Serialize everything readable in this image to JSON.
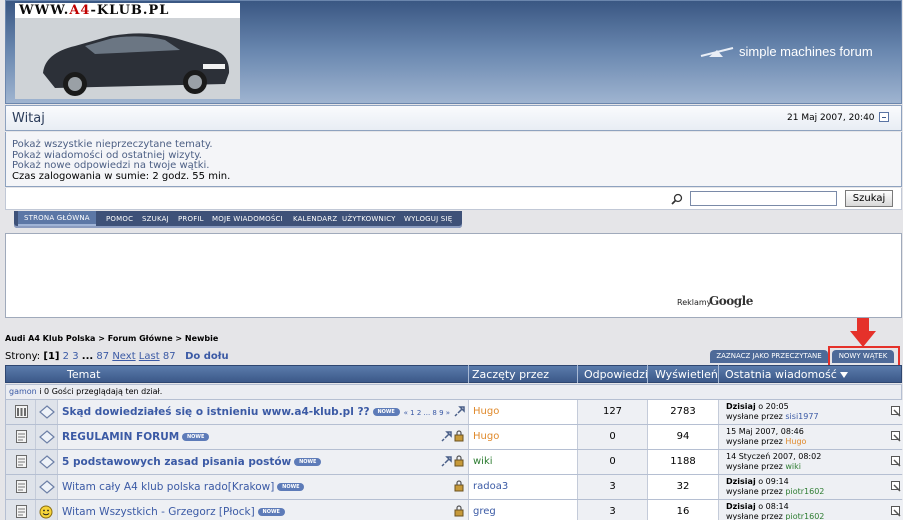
{
  "header": {
    "logo_text_prefix": "WWW.",
    "logo_text_red": "A4",
    "logo_text_suffix": "-KLUB.PL",
    "brand": "simple machines forum"
  },
  "user": {
    "greeting": "Witaj",
    "date": "21 Maj 2007, 20:40",
    "links": [
      "Pokaż wszystkie nieprzeczytane tematy.",
      "Pokaż wiadomości od ostatniej wizyty.",
      "Pokaż nowe odpowiedzi na twoje wątki."
    ],
    "login_time": "Czas zalogowania w sumie: 2 godz. 55 min."
  },
  "search": {
    "button": "Szukaj",
    "value": ""
  },
  "menu": [
    "STRONA GŁÓWNA",
    "POMOC",
    "SZUKAJ",
    "PROFIL",
    "MOJE WIADOMOŚCI",
    "KALENDARZ",
    "UŻYTKOWNICY",
    "WYLOGUJ SIĘ"
  ],
  "ads": {
    "label": "Reklamy",
    "brand": "Google"
  },
  "breadcrumb": "Audi A4 Klub Polska > Forum Główne > Newbie",
  "pages": {
    "label": "Strony:",
    "current": "[1]",
    "p2": "2",
    "p3": "3",
    "ellipsis": "...",
    "p87": "87",
    "next": "Next",
    "last": "Last",
    "last_num": "87",
    "bottom": "Do dołu"
  },
  "buttons": {
    "mark_read": "ZAZNACZ JAKO PRZECZYTANE",
    "new_topic": "NOWY WĄTEK"
  },
  "table": {
    "headers": {
      "topic": "Temat",
      "started_by": "Zaczęty przez",
      "replies": "Odpowiedzi",
      "views": "Wyświetleń",
      "last_post": "Ostatnia wiadomość"
    },
    "viewers_user": "gamon",
    "viewers_text": " i 0 Gości przeglądają ten dział.",
    "new_badge": "NOWE",
    "rows": [
      {
        "subject": "Skąd dowiedziałeś się o istnieniu www.a4-klub.pl ??",
        "pages": "« 1 2 ... 8 9 »",
        "starter": "Hugo",
        "replies": "127",
        "views": "2783",
        "last_date": "Dzisiaj",
        "last_time": " o 20:05",
        "last_by_label": "wysłane przez ",
        "last_by": "sisi1977"
      },
      {
        "subject": "REGULAMIN FORUM",
        "starter": "Hugo",
        "replies": "0",
        "views": "94",
        "last_date": "",
        "last_time": "15 Maj 2007, 08:46",
        "last_by_label": "wysłane przez ",
        "last_by": "Hugo"
      },
      {
        "subject": "5 podstawowych zasad pisania postów",
        "starter": "wiki",
        "replies": "0",
        "views": "1188",
        "last_date": "",
        "last_time": "14 Styczeń 2007, 08:02",
        "last_by_label": "wysłane przez ",
        "last_by": "wiki"
      },
      {
        "subject": "Witam cały A4 klub polska rado[Krakow]",
        "starter": "radoa3",
        "replies": "3",
        "views": "32",
        "last_date": "Dzisiaj",
        "last_time": " o 09:14",
        "last_by_label": "wysłane przez ",
        "last_by": "piotr1602"
      },
      {
        "subject": "Witam Wszystkich - Grzegorz [Płock]",
        "starter": "greg",
        "replies": "3",
        "views": "16",
        "last_date": "Dzisiaj",
        "last_time": " o 08:14",
        "last_by_label": "wysłane przez ",
        "last_by": "piotr1602"
      }
    ]
  },
  "colors": {
    "link": "#3b5aa5",
    "hugo": "#e08a2c",
    "wiki": "#2e7d32",
    "highlight": "#e5312a"
  }
}
